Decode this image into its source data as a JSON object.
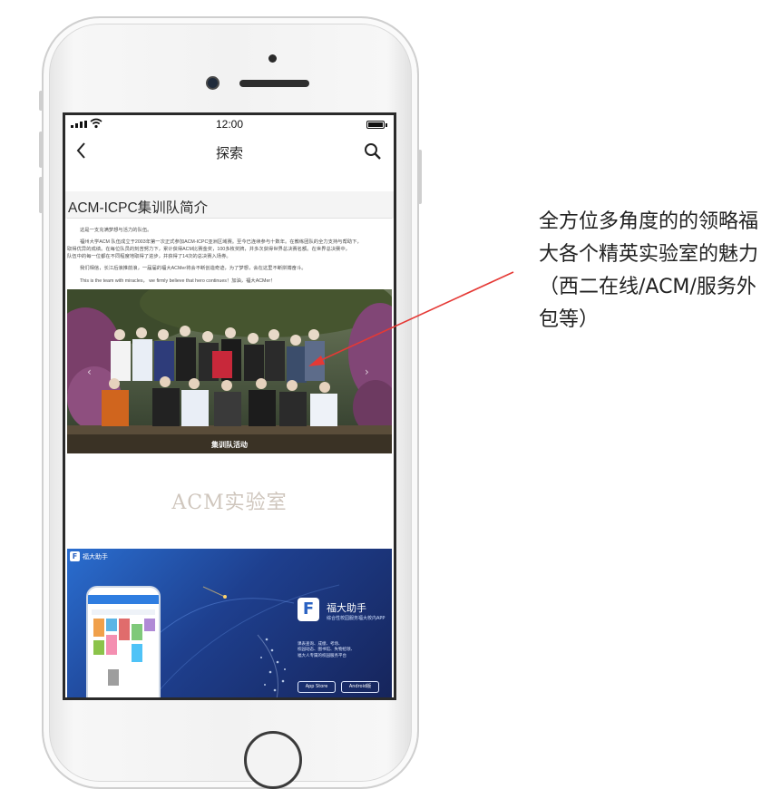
{
  "statusbar": {
    "time": "12:00"
  },
  "navbar": {
    "title": "探索"
  },
  "intro": {
    "title": "ACM-ICPC集训队简介",
    "lines": [
      "这是一支充满梦想与活力的队伍。",
      "福州大学ACM 队伍成立于2003年第一次正式参加ACM-ICPC亚洲区域赛。至今已连续参与十数年。在教练团队的全力支持与帮助下，",
      "取得优异的成绩。在每位队员的刻苦努力下，累计获得ACM比赛金奖，100多枚奖牌，并多次获得世界总决赛名额。在世界总决赛中，",
      "队伍中的每一位都在不同程度地取得了进步，并获得了14次的总决赛入场券。",
      "我们相信，长江后浪推前浪，一届届的福大ACMer将会不断创造奇迹，为了梦想，会在这里不断拼搏奋斗。",
      "This is the team with miracles， we firmly believe that hero continues！加油，福大ACMer！"
    ]
  },
  "photo": {
    "caption": "集训队活动"
  },
  "lab": {
    "title": "ACM实验室"
  },
  "banner": {
    "brand": "福大助手",
    "logo_letter": "F",
    "app_name": "福大助手",
    "app_sub": "综合性校园服务福大校内APP",
    "features": [
      "课表查询、成绩、考场、",
      "校园动态、图书馆、失物招领、",
      "福大人专属的校园服务平台"
    ],
    "store_ios": "App Store",
    "store_android": "Android版"
  },
  "annotation": {
    "text": "全方位多角度的的领略福大各个精英实验室的魅力（西二在线/ACM/服务外包等）",
    "color": "#e53935"
  }
}
